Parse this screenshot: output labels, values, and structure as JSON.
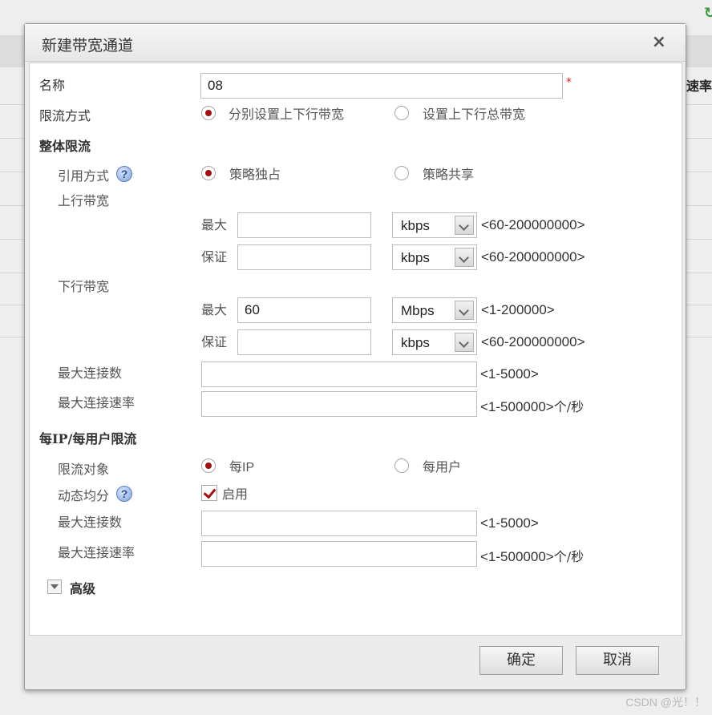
{
  "background": {
    "column_label": "速率",
    "refresh_icon": "refresh-icon"
  },
  "watermark": "CSDN @光！！",
  "dialog": {
    "title": "新建带宽通道",
    "close_label": "×",
    "name": {
      "label": "名称",
      "value": "08",
      "required_mark": "*"
    },
    "limit_mode": {
      "label": "限流方式",
      "options": [
        "分别设置上下行带宽",
        "设置上下行总带宽"
      ],
      "selected": 0
    },
    "overall": {
      "title": "整体限流",
      "reference": {
        "label": "引用方式",
        "options": [
          "策略独占",
          "策略共享"
        ],
        "selected": 0
      },
      "upstream": {
        "label": "上行带宽",
        "max": {
          "label": "最大",
          "value": "",
          "unit": "kbps",
          "range": "<60-200000000>"
        },
        "guarantee": {
          "label": "保证",
          "value": "",
          "unit": "kbps",
          "range": "<60-200000000>"
        }
      },
      "downstream": {
        "label": "下行带宽",
        "max": {
          "label": "最大",
          "value": "60",
          "unit": "Mbps",
          "range": "<1-200000>"
        },
        "guarantee": {
          "label": "保证",
          "value": "",
          "unit": "kbps",
          "range": "<60-200000000>"
        }
      },
      "max_connections": {
        "label": "最大连接数",
        "value": "",
        "range": "<1-5000>"
      },
      "max_connection_rate": {
        "label": "最大连接速率",
        "value": "",
        "range": "<1-500000>",
        "unit": "个/秒"
      }
    },
    "per_ip": {
      "title": "每IP/每用户限流",
      "target": {
        "label": "限流对象",
        "options": [
          "每IP",
          "每用户"
        ],
        "selected": 0
      },
      "dynamic": {
        "label": "动态均分",
        "checkbox_label": "启用",
        "checked": true
      },
      "max_connections": {
        "label": "最大连接数",
        "value": "",
        "range": "<1-5000>"
      },
      "max_connection_rate": {
        "label": "最大连接速率",
        "value": "",
        "range": "<1-500000>",
        "unit": "个/秒"
      }
    },
    "advanced_label": "高级",
    "help_glyph": "?",
    "buttons": {
      "ok": "确定",
      "cancel": "取消"
    }
  }
}
